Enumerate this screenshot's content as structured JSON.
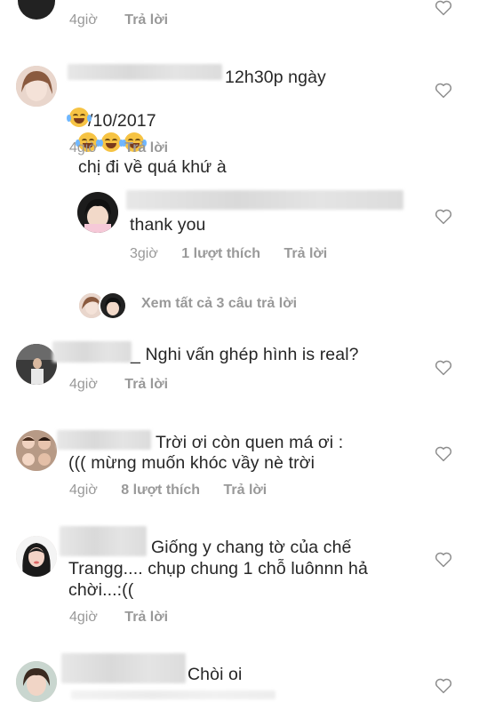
{
  "comments": [
    {
      "time": "4giờ",
      "reply": "Trả lời"
    },
    {
      "text_line1": "12h30p ngày",
      "text_line2": "7/10/2017",
      "text_line2b": "chị đi về quá khứ à",
      "time": "4giờ",
      "reply": "Trả lời"
    },
    {
      "text": "thank you",
      "time": "3giờ",
      "likes": "1 lượt thích",
      "reply": "Trả lời"
    },
    {
      "view_replies": "Xem tất cả 3 câu trả lời"
    },
    {
      "text": "_ Nghi vấn ghép hình is real?",
      "time": "4giờ",
      "reply": "Trả lời"
    },
    {
      "text_line1": "Trời ơi còn quen má ơi :",
      "text_line2": "((( mừng muốn khóc vầy nè trời",
      "time": "4giờ",
      "likes": "8 lượt thích",
      "reply": "Trả lời"
    },
    {
      "text_line1": "Giống y chang tờ của chế",
      "text_line2": "Trangg.... chụp chung 1 chỗ luônnn hả",
      "text_line3": "chời...:((",
      "time": "4giờ",
      "reply": "Trả lời"
    },
    {
      "text": "Chòi oi"
    }
  ],
  "icons": {
    "heart": "heart-outline-icon",
    "emoji": "face-with-tears-of-joy-icon"
  },
  "colors": {
    "text": "#262626",
    "meta": "#999999",
    "heart_stroke": "#8e8e8e"
  }
}
